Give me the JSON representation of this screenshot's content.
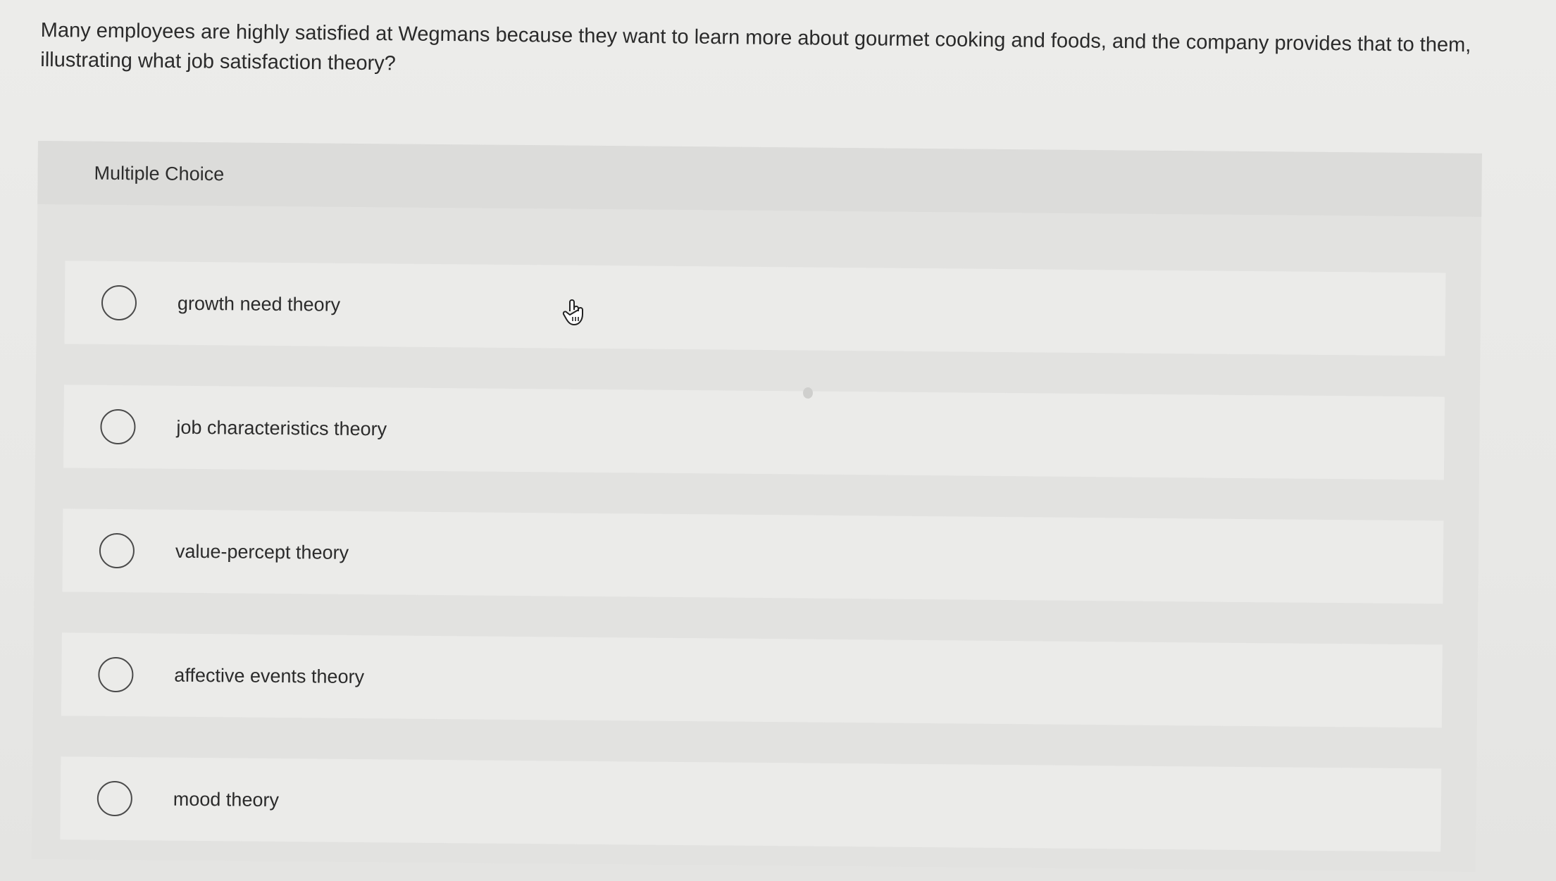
{
  "question": {
    "text": "Many employees are highly satisfied at Wegmans because they want to learn more about gourmet cooking and foods, and the company provides that to them, illustrating what job satisfaction theory?"
  },
  "multiple_choice": {
    "label": "Multiple Choice",
    "options": [
      {
        "label": "growth need theory",
        "selected": false
      },
      {
        "label": "job characteristics theory",
        "selected": false
      },
      {
        "label": "value-percept theory",
        "selected": false
      },
      {
        "label": "affective events theory",
        "selected": false
      },
      {
        "label": "mood theory",
        "selected": false
      }
    ]
  },
  "icons": {
    "cursor": "hand-pointer-icon",
    "radio": "radio-circle-icon"
  }
}
